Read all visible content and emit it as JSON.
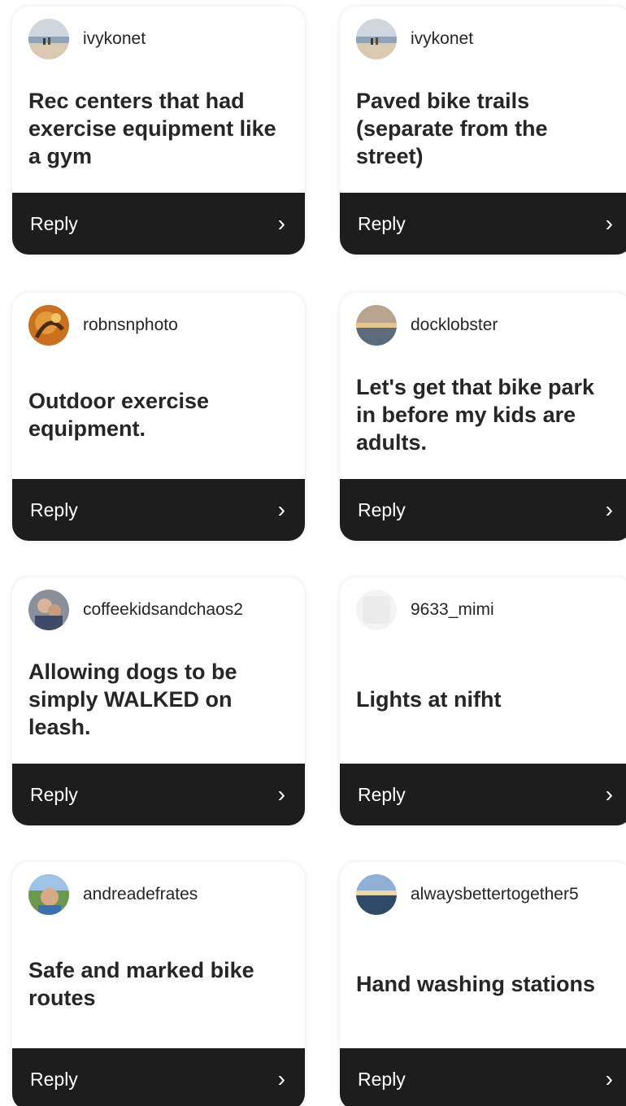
{
  "cards": [
    {
      "username": "ivykonet",
      "comment": "Rec centers that had exercise equipment like a gym",
      "avatar": "beach-photo-avatar",
      "reply_label": "Reply"
    },
    {
      "username": "ivykonet",
      "comment": "Paved bike trails (separate from the street)",
      "avatar": "beach-photo-avatar",
      "reply_label": "Reply"
    },
    {
      "username": "robnsnphoto",
      "comment": "Outdoor exercise equipment.",
      "avatar": "orange-art-avatar",
      "reply_label": "Reply"
    },
    {
      "username": "docklobster",
      "comment": "Let's get that bike park in before my kids are adults.",
      "avatar": "sunset-sea-avatar",
      "reply_label": "Reply"
    },
    {
      "username": "coffeekidsandchaos2",
      "comment": "Allowing dogs to be simply WALKED on leash.",
      "avatar": "family-photo-avatar",
      "reply_label": "Reply"
    },
    {
      "username": "9633_mimi",
      "comment": "Lights at nifht",
      "avatar": "default-avatar",
      "reply_label": "Reply"
    },
    {
      "username": "andreadefrates",
      "comment": "Safe and marked bike routes",
      "avatar": "outdoor-selfie-avatar",
      "reply_label": "Reply"
    },
    {
      "username": "alwaysbettertogether5",
      "comment": "Hand washing stations",
      "avatar": "lake-sunset-avatar",
      "reply_label": "Reply"
    }
  ],
  "colors": {
    "reply_bar": "#1d1d1d",
    "text": "#262626",
    "background": "#ffffff"
  }
}
